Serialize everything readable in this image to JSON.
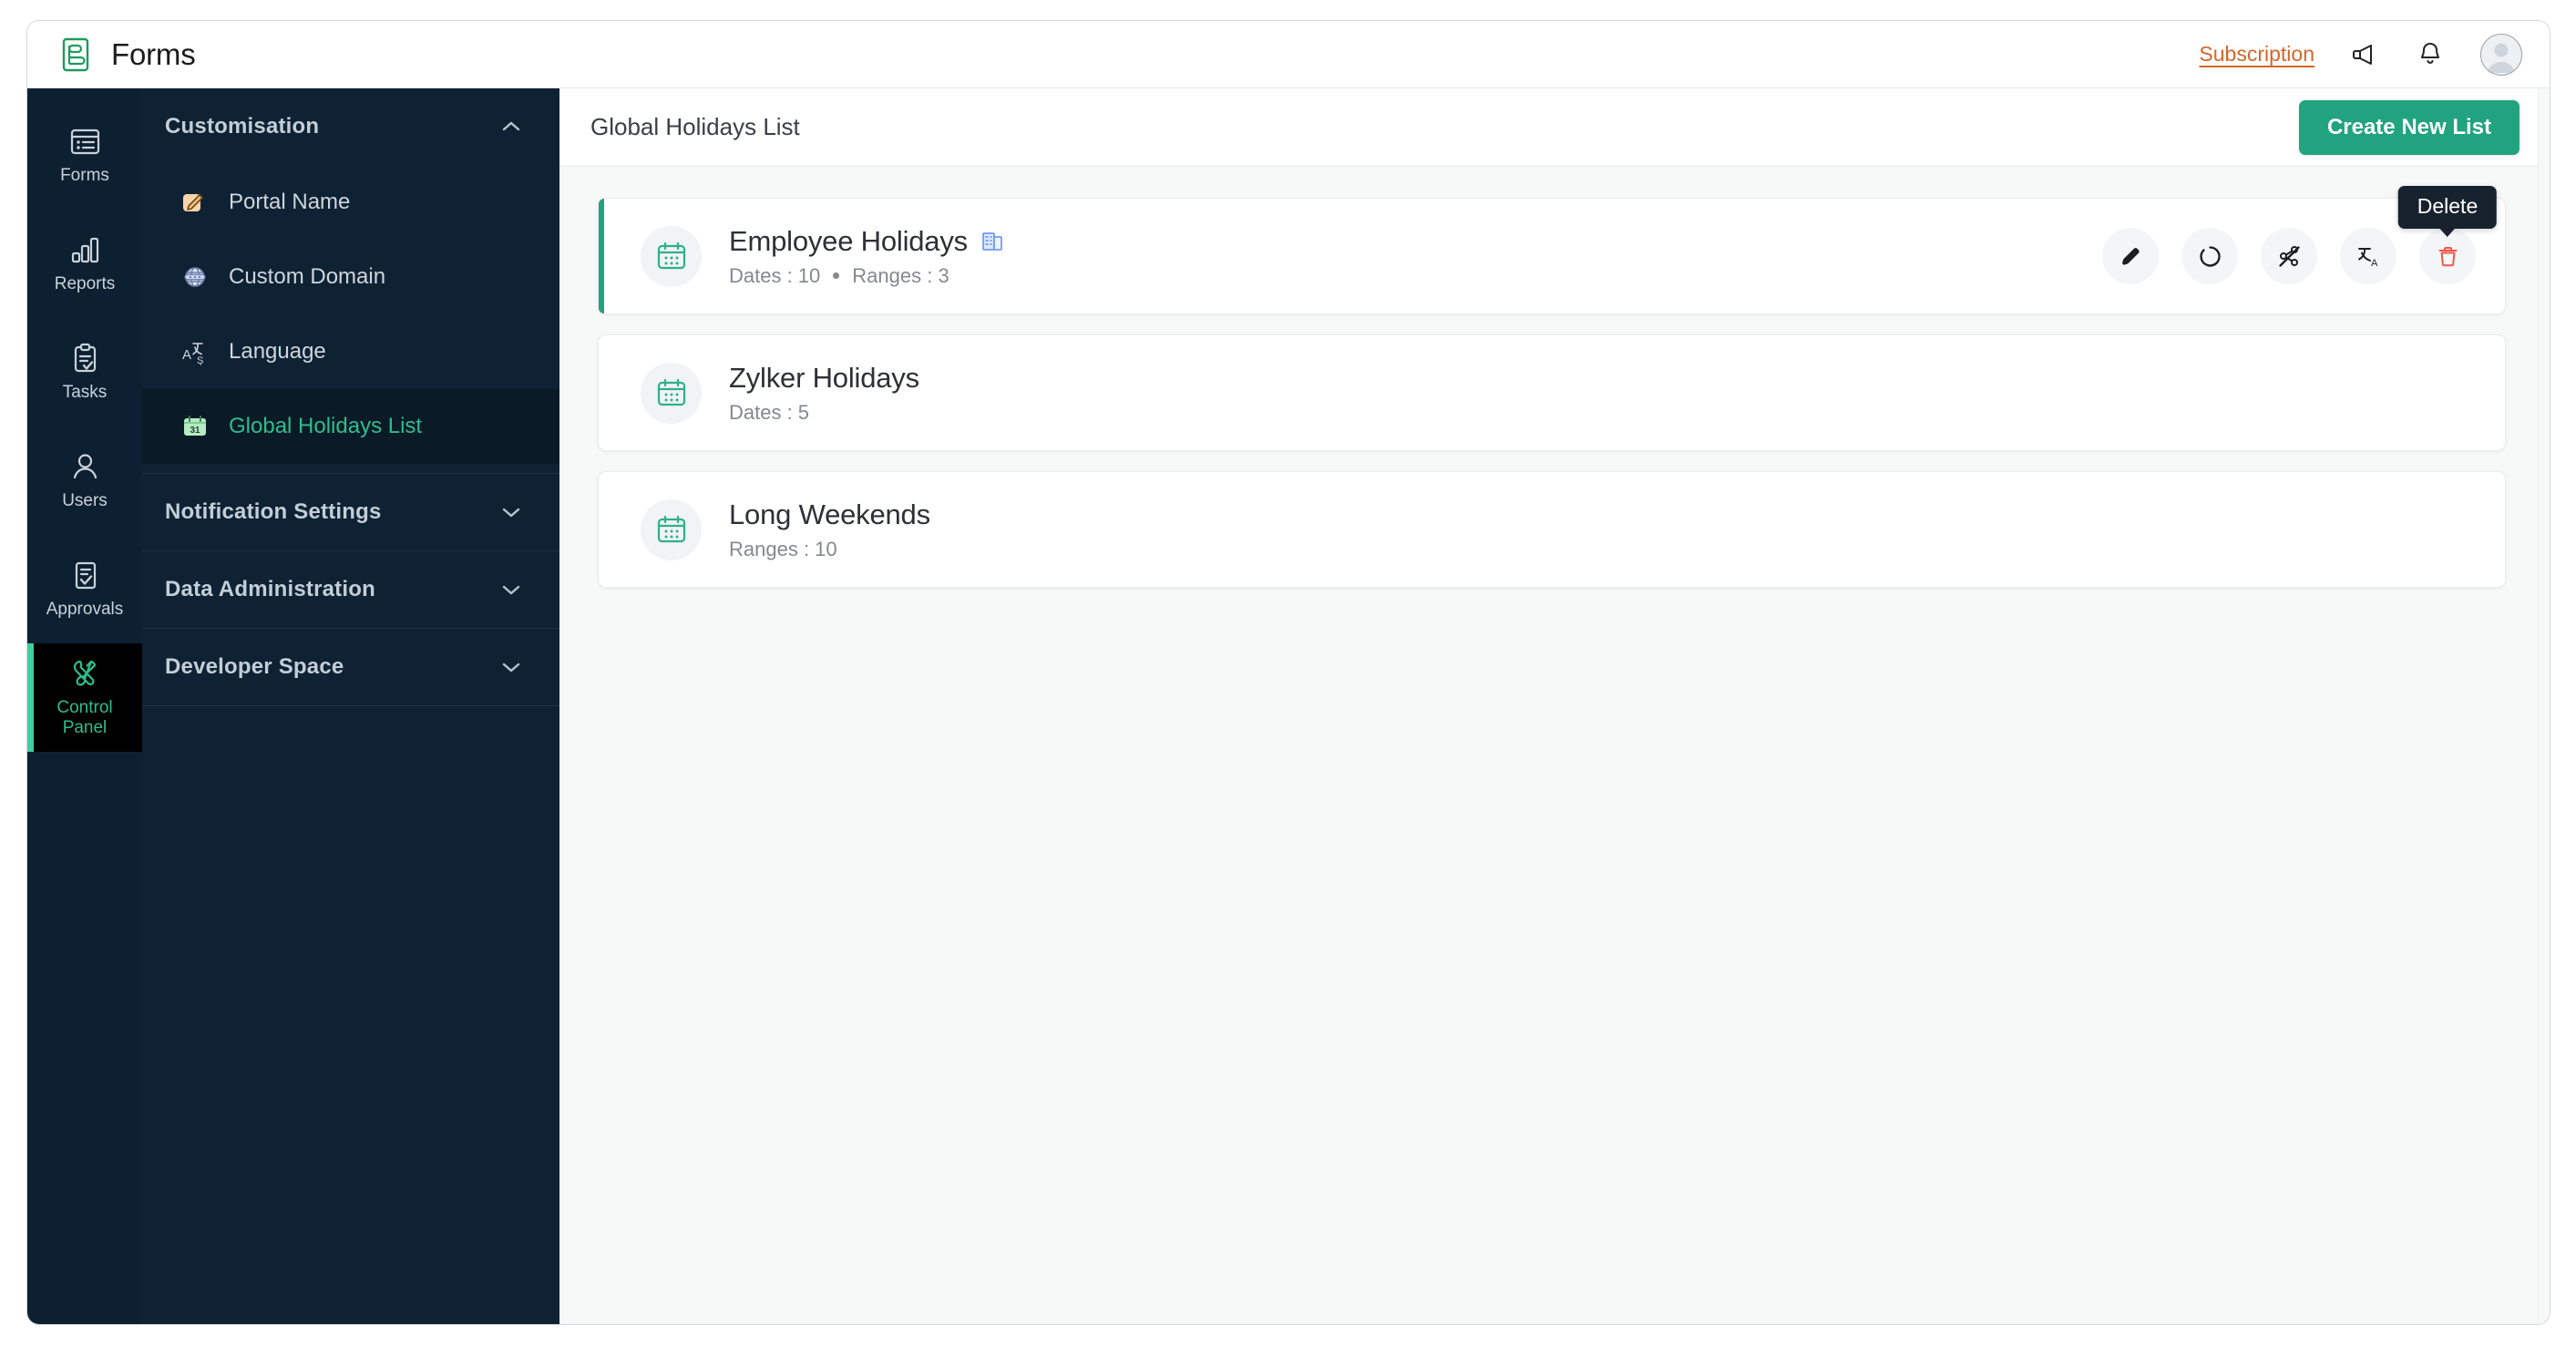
{
  "app": {
    "brand_name": "Forms",
    "logo_icon": "forms-logo-icon"
  },
  "topbar": {
    "subscription_label": "Subscription",
    "announcement_icon": "megaphone-icon",
    "notification_icon": "bell-icon",
    "avatar_icon": "user-avatar-icon"
  },
  "rail": {
    "items": [
      {
        "label": "Forms",
        "icon": "forms-icon",
        "active": false
      },
      {
        "label": "Reports",
        "icon": "bar-chart-icon",
        "active": false
      },
      {
        "label": "Tasks",
        "icon": "clipboard-check-icon",
        "active": false
      },
      {
        "label": "Users",
        "icon": "user-icon",
        "active": false
      },
      {
        "label": "Approvals",
        "icon": "document-check-icon",
        "active": false
      },
      {
        "label": "Control Panel",
        "label_line1": "Control",
        "label_line2": "Panel",
        "icon": "tools-icon",
        "active": true
      }
    ]
  },
  "sidebar": {
    "sections": [
      {
        "title": "Customisation",
        "expanded": true,
        "chevron": "chevron-up-icon"
      },
      {
        "title": "Notification Settings",
        "expanded": false,
        "chevron": "chevron-down-icon"
      },
      {
        "title": "Data Administration",
        "expanded": false,
        "chevron": "chevron-down-icon"
      },
      {
        "title": "Developer Space",
        "expanded": false,
        "chevron": "chevron-down-icon"
      }
    ],
    "customisation_items": [
      {
        "label": "Portal Name",
        "icon": "pencil-square-icon",
        "active": false
      },
      {
        "label": "Custom Domain",
        "icon": "globe-icon",
        "active": false
      },
      {
        "label": "Language",
        "icon": "translate-icon",
        "active": false
      },
      {
        "label": "Global Holidays List",
        "icon": "calendar-31-icon",
        "active": true
      }
    ]
  },
  "content": {
    "title": "Global Holidays List",
    "create_button_label": "Create New List",
    "tooltip": {
      "label": "Delete",
      "target": "delete-button"
    },
    "cards": [
      {
        "name": "Employee Holidays",
        "icon": "calendar-icon",
        "org_badge": "organization-icon",
        "meta": [
          "Dates : 10",
          "Ranges : 3"
        ],
        "selected": true,
        "actions": [
          {
            "name": "edit-button",
            "icon": "pencil-icon",
            "label": "Edit"
          },
          {
            "name": "sync-button",
            "icon": "refresh-icon",
            "label": "Sync"
          },
          {
            "name": "disable-share-button",
            "icon": "share-off-icon",
            "label": "Disable"
          },
          {
            "name": "translate-button",
            "icon": "translate-icon",
            "label": "Translate"
          },
          {
            "name": "delete-button",
            "icon": "trash-icon",
            "label": "Delete"
          }
        ]
      },
      {
        "name": "Zylker Holidays",
        "icon": "calendar-icon",
        "org_badge": null,
        "meta": [
          "Dates : 5"
        ],
        "selected": false,
        "actions": []
      },
      {
        "name": "Long Weekends",
        "icon": "calendar-icon",
        "org_badge": null,
        "meta": [
          "Ranges : 10"
        ],
        "selected": false,
        "actions": []
      }
    ]
  },
  "colors": {
    "brand_green": "#22a37f",
    "accent_orange": "#d2662a",
    "rail_bg": "#0d2031",
    "sidebar_bg": "#0f2233",
    "danger_red": "#f0564a",
    "tooltip_bg": "#18222e"
  }
}
